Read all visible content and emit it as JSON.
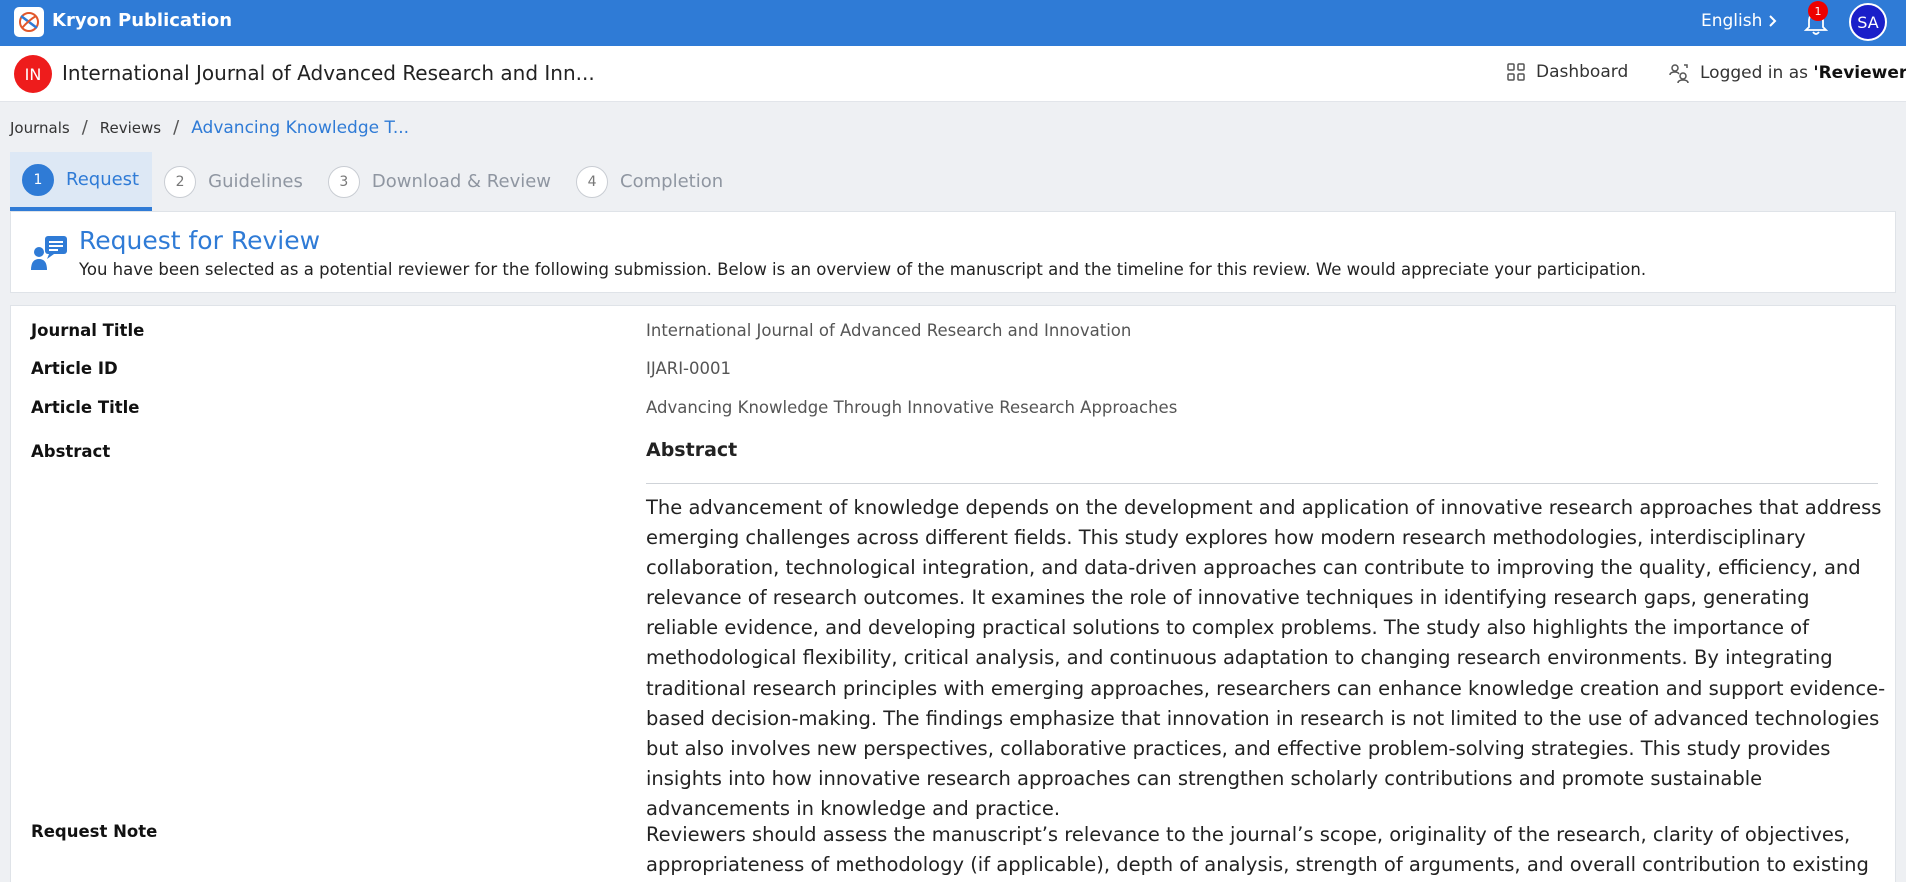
{
  "app": {
    "brand": "Kryon Publication",
    "language": "English",
    "notification_count": "1",
    "user_initials": "SA"
  },
  "subheader": {
    "journal_initials": "IN",
    "journal_name": "International Journal of Advanced Research and Inn...",
    "dashboard_label": "Dashboard",
    "logged_prefix": "Logged in as ",
    "logged_role": "'Reviewer'"
  },
  "breadcrumb": [
    {
      "label": "Journals"
    },
    {
      "label": "Reviews"
    },
    {
      "label": "Advancing Knowledge T..."
    }
  ],
  "steps": [
    {
      "num": "1",
      "label": "Request"
    },
    {
      "num": "2",
      "label": "Guidelines"
    },
    {
      "num": "3",
      "label": "Download & Review"
    },
    {
      "num": "4",
      "label": "Completion"
    }
  ],
  "request": {
    "title": "Request for Review",
    "description": "You have been selected as a potential reviewer for the following submission. Below is an overview of the manuscript and the timeline for this review. We would appreciate your participation."
  },
  "details": {
    "journal_title_label": "Journal Title",
    "journal_title_value": "International Journal of Advanced Research and Innovation",
    "article_id_label": "Article ID",
    "article_id_value": "IJARI-0001",
    "article_title_label": "Article Title",
    "article_title_value": "Advancing Knowledge Through Innovative Research Approaches",
    "abstract_label": "Abstract",
    "abstract_heading": "Abstract",
    "abstract_text": "The advancement of knowledge depends on the development and application of innovative research approaches that address emerging challenges across different fields. This study explores how modern research methodologies, interdisciplinary collaboration, technological integration, and data-driven approaches can contribute to improving the quality, efficiency, and relevance of research outcomes. It examines the role of innovative techniques in identifying research gaps, generating reliable evidence, and developing practical solutions to complex problems. The study also highlights the importance of methodological flexibility, critical analysis, and continuous adaptation to changing research environments. By integrating traditional research principles with emerging approaches, researchers can enhance knowledge creation and support evidence-based decision-making. The findings emphasize that innovation in research is not limited to the use of advanced technologies but also involves new perspectives, collaborative practices, and effective problem-solving strategies. This study provides insights into how innovative research approaches can strengthen scholarly contributions and promote sustainable advancements in knowledge and practice.",
    "request_note_label": "Request Note",
    "request_note_text": "Reviewers should assess the manuscript’s relevance to the journal’s scope, originality of the research, clarity of objectives, appropriateness of methodology (if applicable), depth of analysis, strength of arguments, and overall contribution to existing"
  }
}
